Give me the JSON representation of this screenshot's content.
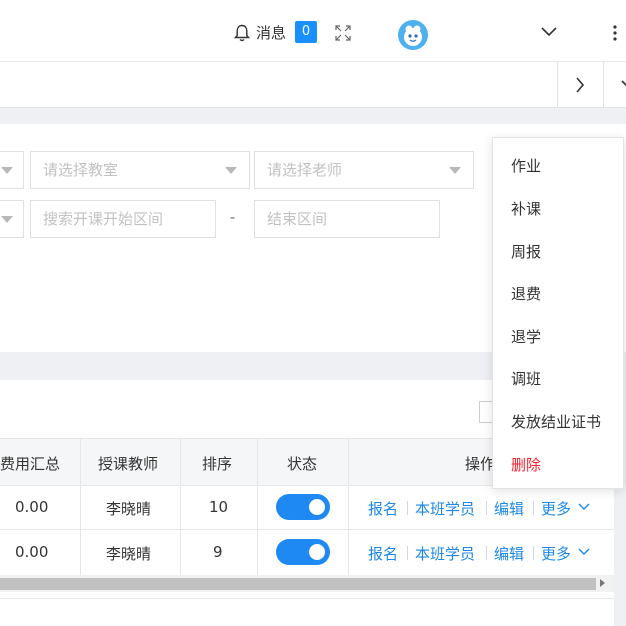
{
  "header": {
    "messages_label": "消息",
    "messages_count": "0"
  },
  "filters": {
    "classroom_placeholder": "请选择教室",
    "teacher_placeholder": "请选择老师",
    "start_range_placeholder": "搜索开课开始区间",
    "range_separator": "-",
    "end_range_placeholder": "结束区间"
  },
  "table": {
    "columns": [
      "费用汇总",
      "授课教师",
      "排序",
      "状态",
      "操作"
    ],
    "rows": [
      {
        "fee_total": "0.00",
        "teacher": "李晓晴",
        "order": "10",
        "status_on": true
      },
      {
        "fee_total": "0.00",
        "teacher": "李晓晴",
        "order": "9",
        "status_on": true
      }
    ],
    "actions": {
      "signup": "报名",
      "students": "本班学员",
      "edit": "编辑",
      "more": "更多"
    }
  },
  "more_menu": {
    "items": [
      "作业",
      "补课",
      "周报",
      "退费",
      "退学",
      "调班",
      "发放结业证书",
      "删除"
    ]
  },
  "colors": {
    "accent": "#1e88e5",
    "danger": "#f5222d",
    "badge": "#1890ff"
  }
}
